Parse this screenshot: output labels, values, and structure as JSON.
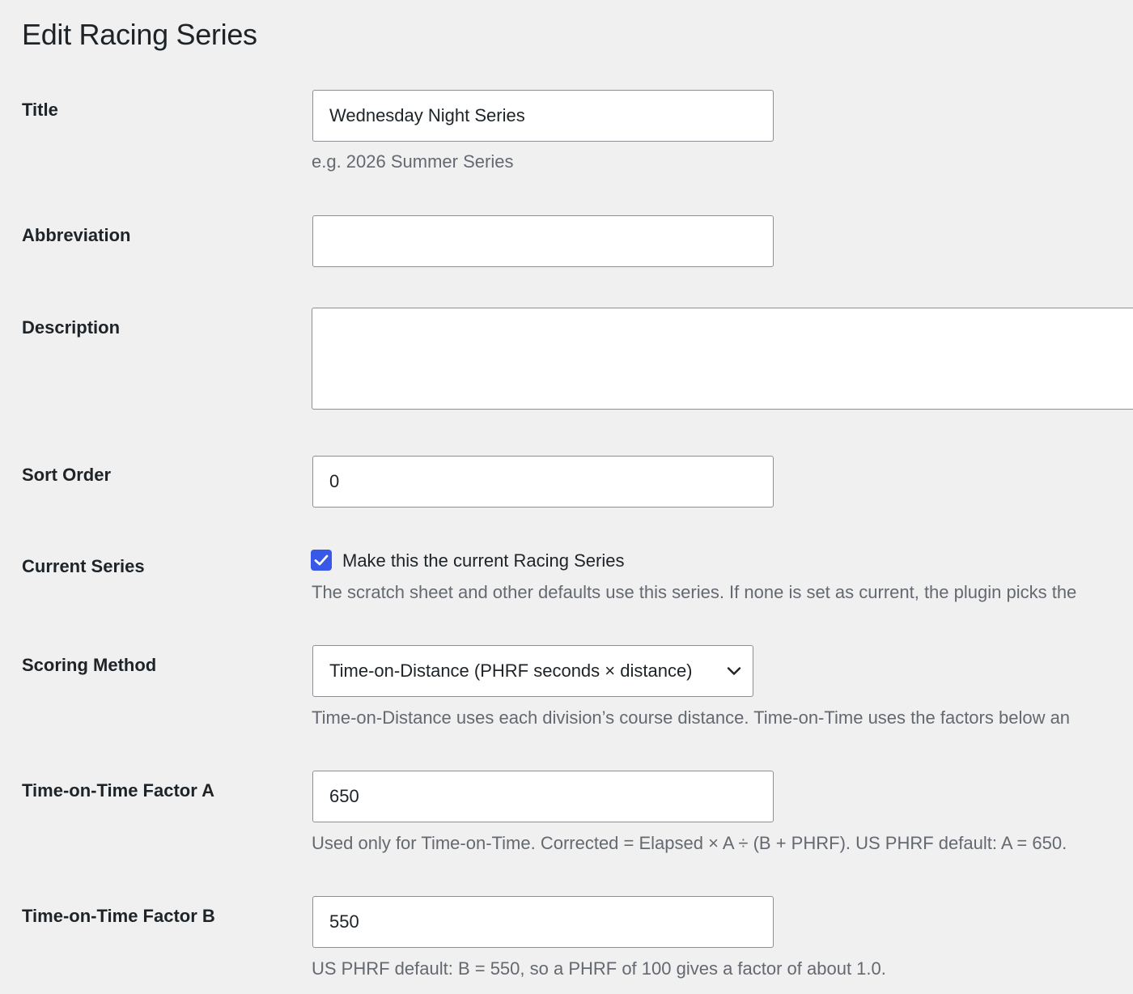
{
  "page": {
    "title": "Edit Racing Series"
  },
  "fields": {
    "title": {
      "label": "Title",
      "value": "Wednesday Night Series",
      "description": "e.g. 2026 Summer Series"
    },
    "abbreviation": {
      "label": "Abbreviation",
      "value": ""
    },
    "description": {
      "label": "Description",
      "value": ""
    },
    "sort_order": {
      "label": "Sort Order",
      "value": "0"
    },
    "current_series": {
      "label": "Current Series",
      "checked": true,
      "checkbox_label": "Make this the current Racing Series",
      "description": "The scratch sheet and other defaults use this series. If none is set as current, the plugin picks the"
    },
    "scoring_method": {
      "label": "Scoring Method",
      "selected": "Time-on-Distance (PHRF seconds × distance)",
      "description": "Time-on-Distance uses each division’s course distance. Time-on-Time uses the factors below an"
    },
    "factor_a": {
      "label": "Time-on-Time Factor A",
      "value": "650",
      "description": "Used only for Time-on-Time. Corrected = Elapsed × A ÷ (B + PHRF). US PHRF default: A = 650."
    },
    "factor_b": {
      "label": "Time-on-Time Factor B",
      "value": "550",
      "description": "US PHRF default: B = 550, so a PHRF of 100 gives a factor of about 1.0."
    }
  },
  "colors": {
    "background": "#f0f0f1",
    "checkbox_accent": "#3858e9",
    "field_border": "#8c8f94",
    "description_text": "#646970"
  }
}
